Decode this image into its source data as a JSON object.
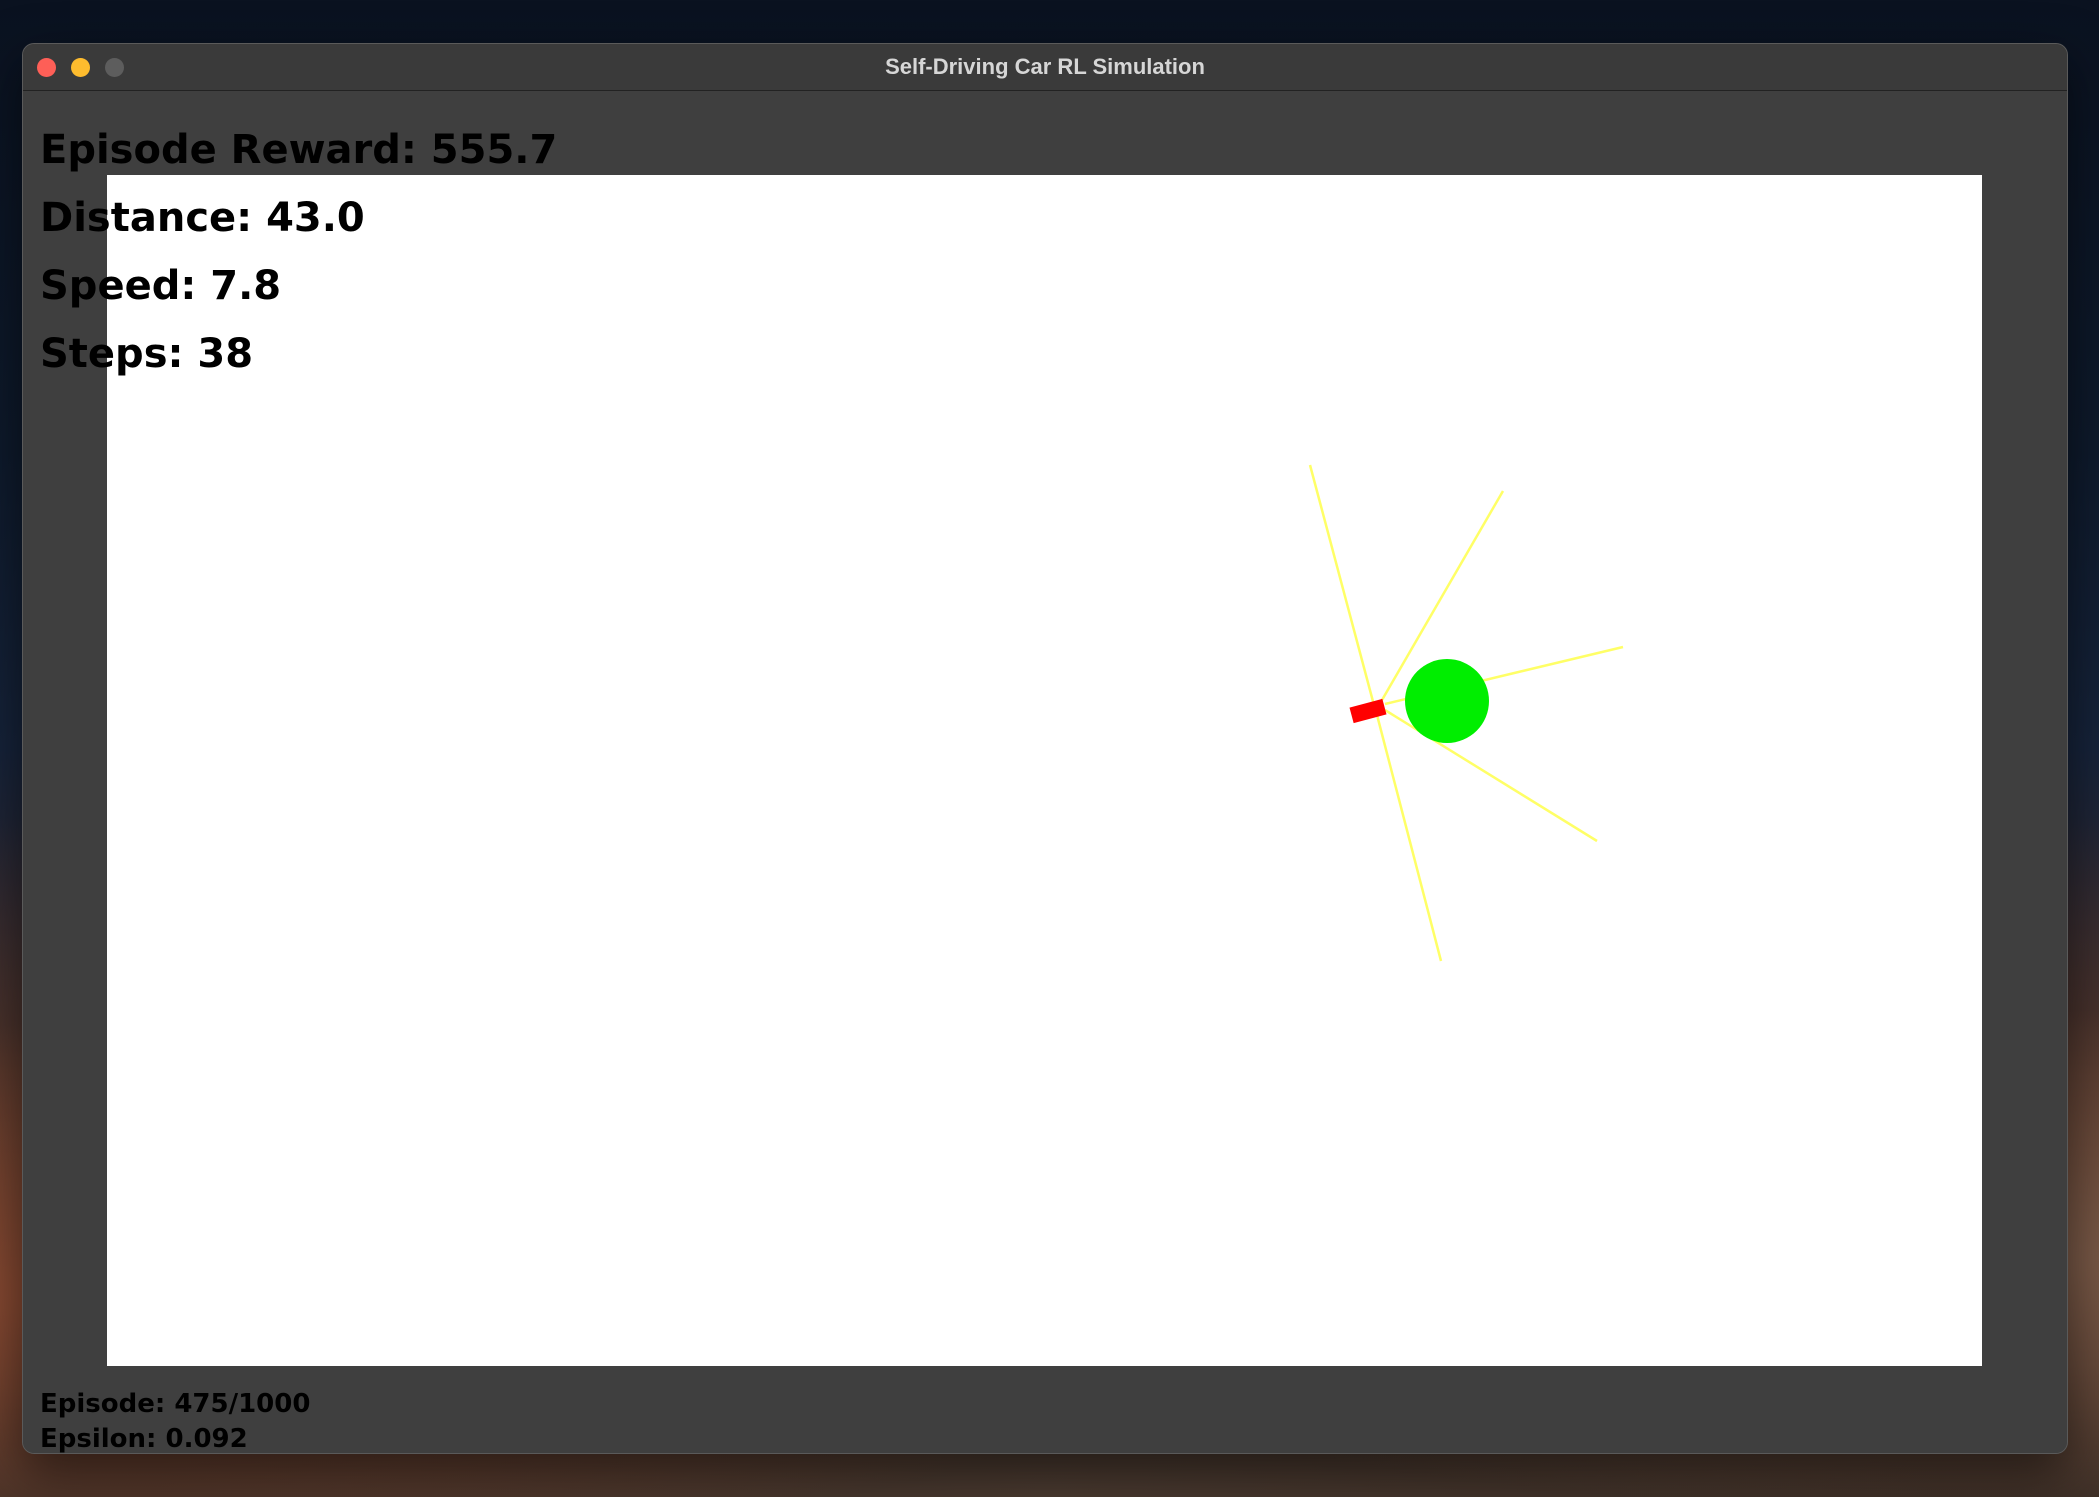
{
  "window": {
    "title": "Self-Driving Car RL Simulation"
  },
  "hud": {
    "episode_reward": "Episode Reward: 555.7",
    "distance": "Distance: 43.0",
    "speed": "Speed: 7.8",
    "steps": "Steps: 38",
    "episode": "Episode: 475/1000",
    "epsilon": "Epsilon: 0.092"
  },
  "colors": {
    "car": "#ff0000",
    "target": "#00ee00",
    "sensor_ray": "#ffff66",
    "canvas": "#ffffff",
    "window_bg": "#3f3f3f"
  }
}
